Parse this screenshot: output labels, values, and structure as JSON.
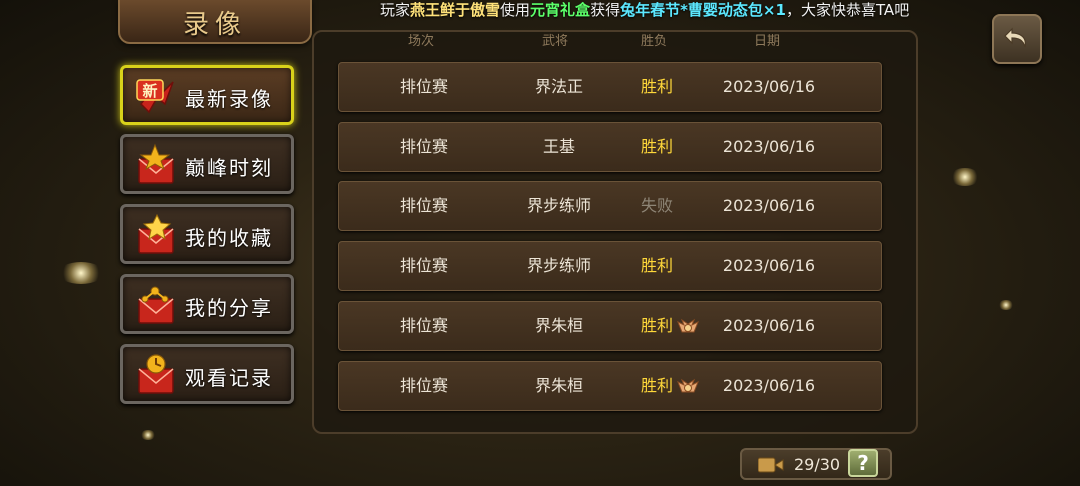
{
  "title": "录像",
  "marquee": {
    "prefix": "玩家",
    "player": "燕王鲜于傲雪",
    "used": "使用",
    "item": "元宵礼盒",
    "obtained": "获得",
    "reward": "兔年春节*曹婴动态包×1",
    "suffix": "，大家快恭喜TA吧"
  },
  "sidebar": [
    {
      "label": "最新录像",
      "icon": "new-badge-icon",
      "active": true
    },
    {
      "label": "巅峰时刻",
      "icon": "peak-envelope-icon",
      "active": false
    },
    {
      "label": "我的收藏",
      "icon": "star-envelope-icon",
      "active": false
    },
    {
      "label": "我的分享",
      "icon": "share-envelope-icon",
      "active": false
    },
    {
      "label": "观看记录",
      "icon": "history-envelope-icon",
      "active": false
    }
  ],
  "table": {
    "headers": [
      "场次",
      "武将",
      "胜负",
      "日期"
    ],
    "rows": [
      {
        "match": "排位赛",
        "general": "界法正",
        "result": "胜利",
        "won": true,
        "badge": false,
        "date": "2023/06/16"
      },
      {
        "match": "排位赛",
        "general": "王基",
        "result": "胜利",
        "won": true,
        "badge": false,
        "date": "2023/06/16"
      },
      {
        "match": "排位赛",
        "general": "界步练师",
        "result": "失败",
        "won": false,
        "badge": false,
        "date": "2023/06/16"
      },
      {
        "match": "排位赛",
        "general": "界步练师",
        "result": "胜利",
        "won": true,
        "badge": false,
        "date": "2023/06/16"
      },
      {
        "match": "排位赛",
        "general": "界朱桓",
        "result": "胜利",
        "won": true,
        "badge": true,
        "date": "2023/06/16"
      },
      {
        "match": "排位赛",
        "general": "界朱桓",
        "result": "胜利",
        "won": true,
        "badge": true,
        "date": "2023/06/16"
      }
    ]
  },
  "counter": {
    "value": "29/30",
    "icon": "video-camera-icon"
  },
  "help_label": "?",
  "colors": {
    "win": "#ffd83a",
    "lose": "#8e8576",
    "active_border": "#d9d21a"
  }
}
